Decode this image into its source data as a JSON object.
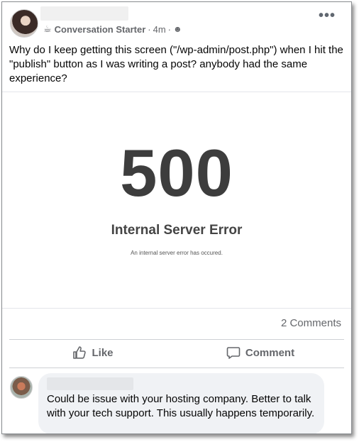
{
  "post": {
    "group_badge": "Conversation Starter",
    "time": "4m",
    "separator": "·",
    "badge_icon": "coffee-cup-icon",
    "privacy_icon": "globe-icon",
    "text": "Why do I keep getting this screen (\"/wp-admin/post.php\") when I hit the \"publish\" button as I was writing a post?  anybody had the same experience?"
  },
  "error_image": {
    "code": "500",
    "title": "Internal Server Error",
    "subtitle": "An internal server error has occured."
  },
  "stats": {
    "comments": "2 Comments"
  },
  "actions": {
    "like": "Like",
    "comment": "Comment"
  },
  "comment": {
    "text": "Could be issue with your hosting company. Better to talk with your tech support. This usually happens temporarily."
  },
  "colors": {
    "secondary_text": "#65676b",
    "bubble_bg": "#f0f2f5",
    "error_text": "#3d3d3d"
  }
}
